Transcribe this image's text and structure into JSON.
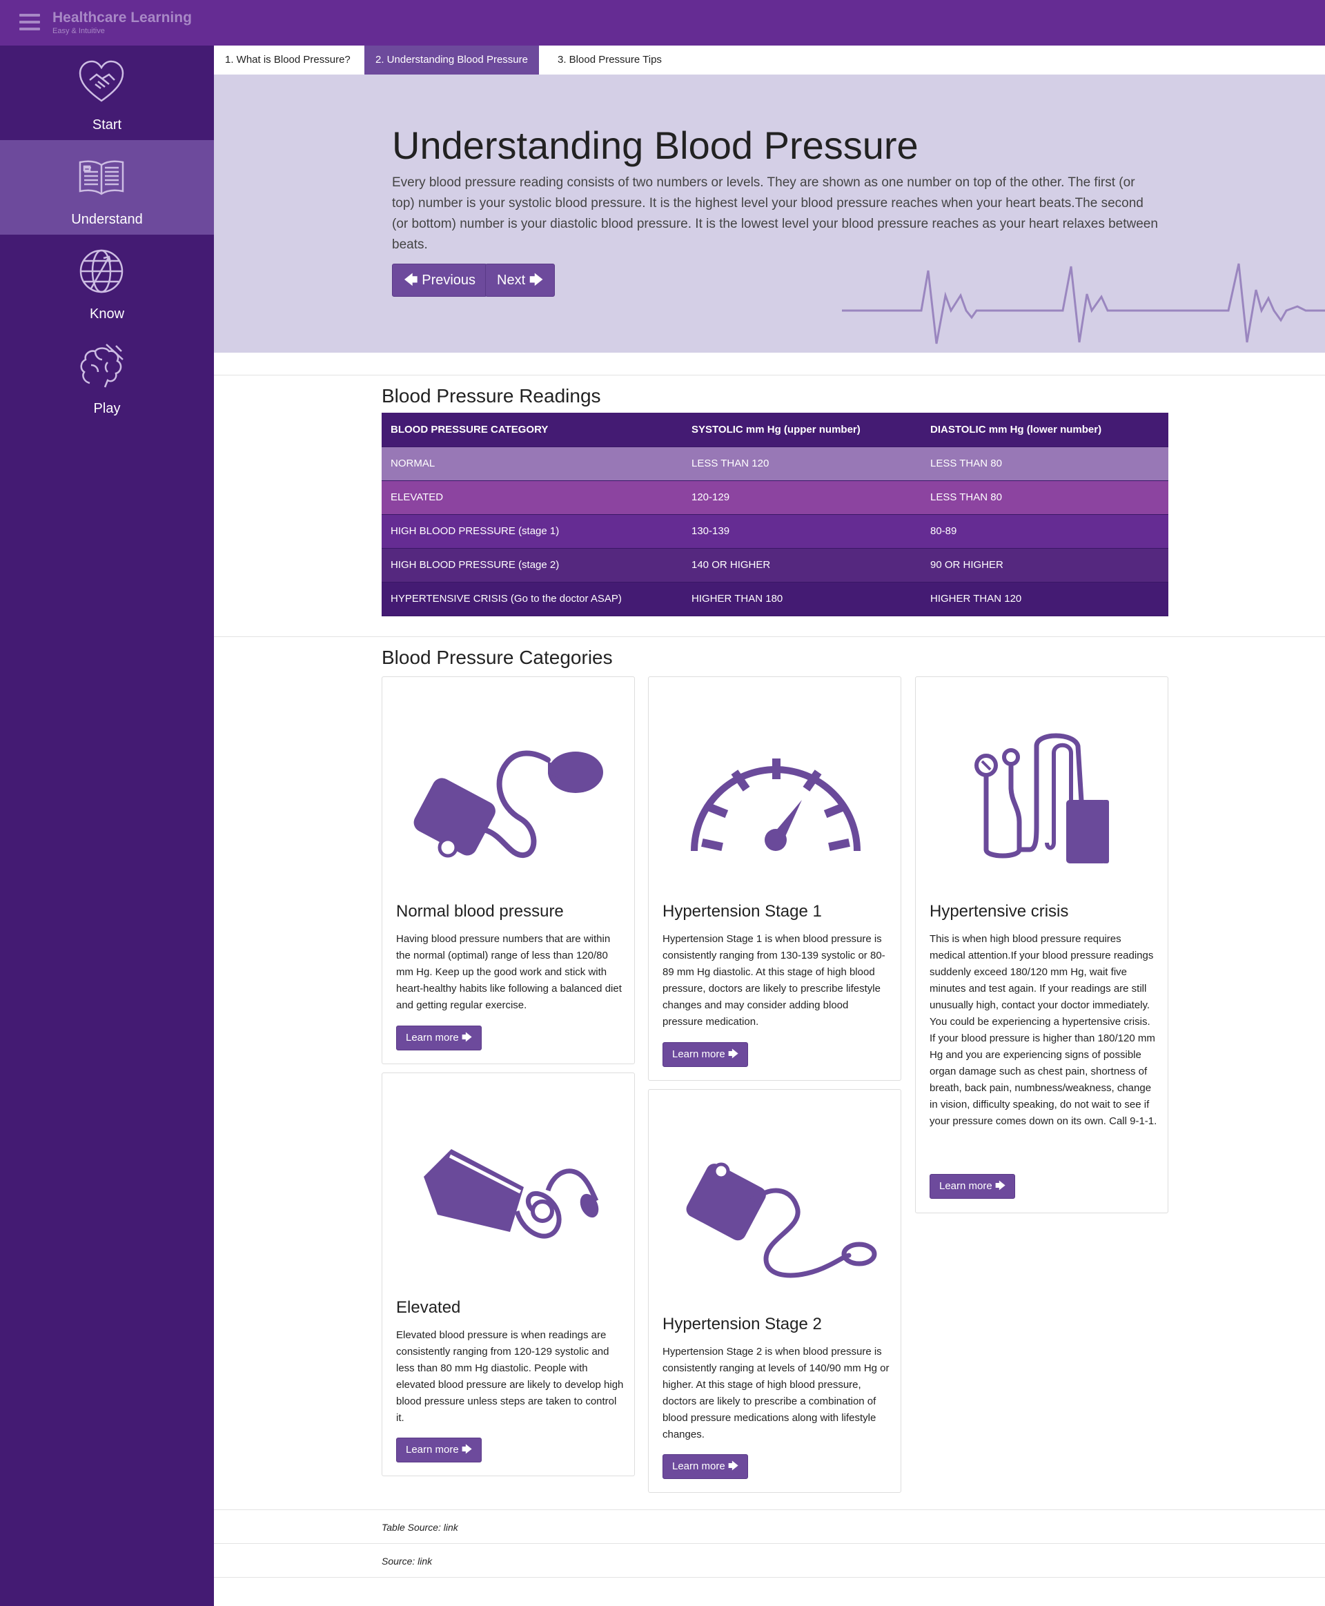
{
  "header": {
    "brand_title": "Healthcare Learning",
    "brand_subtitle": "Easy & Intuitive"
  },
  "sidebar": {
    "items": [
      {
        "label": "Start",
        "icon": "heart-handshake-icon"
      },
      {
        "label": "Understand",
        "icon": "open-book-icon"
      },
      {
        "label": "Know",
        "icon": "globe-arrow-icon"
      },
      {
        "label": "Play",
        "icon": "brain-icon"
      }
    ],
    "active_index": 1
  },
  "tabs": [
    {
      "label": "1. What is Blood Pressure?"
    },
    {
      "label": "2. Understanding Blood Pressure"
    },
    {
      "label": "3. Blood Pressure Tips"
    }
  ],
  "hero": {
    "title": "Understanding Blood Pressure",
    "body": "Every blood pressure reading consists of two numbers or levels. They are shown as one number on top of the other. The first (or top) number is your systolic blood pressure. It is the highest level your blood pressure reaches when your heart beats.The second (or bottom) number is your diastolic blood pressure. It is the lowest level your blood pressure reaches as your heart relaxes between beats.",
    "prev_label": "Previous",
    "next_label": "Next"
  },
  "readings": {
    "title": "Blood Pressure Readings",
    "headers": [
      "BLOOD PRESSURE CATEGORY",
      "SYSTOLIC mm Hg (upper number)",
      "DIASTOLIC mm Hg (lower number)"
    ],
    "rows": [
      [
        "NORMAL",
        "LESS THAN 120",
        "LESS THAN 80"
      ],
      [
        "ELEVATED",
        "120-129",
        "LESS THAN 80"
      ],
      [
        "HIGH BLOOD PRESSURE (stage 1)",
        "130-139",
        "80-89"
      ],
      [
        "HIGH BLOOD PRESSURE (stage 2)",
        "140 OR HIGHER",
        "90 OR HIGHER"
      ],
      [
        "HYPERTENSIVE CRISIS (Go to the doctor ASAP)",
        "HIGHER THAN 180",
        "HIGHER THAN 120"
      ]
    ]
  },
  "categories": {
    "title": "Blood Pressure Categories",
    "cards": [
      {
        "title": "Normal blood pressure",
        "body": "Having blood pressure numbers that are within the normal (optimal) range of less than 120/80 mm Hg. Keep up the good work and stick with heart-healthy habits like following a balanced diet and getting regular exercise.",
        "button": "Learn more",
        "icon": "blood-pressure-cuff-icon"
      },
      {
        "title": "Hypertension Stage 1",
        "body": "Hypertension Stage 1 is when blood pressure is consistently ranging from 130-139 systolic or 80-89 mm Hg diastolic. At this stage of high blood pressure, doctors are likely to prescribe lifestyle changes and may consider adding blood pressure medication.",
        "button": "Learn more",
        "icon": "gauge-icon"
      },
      {
        "title": "Hypertensive crisis",
        "body": "This is when high blood pressure requires medical attention.If your blood pressure readings suddenly exceed 180/120 mm Hg, wait five minutes and test again. If your readings are still unusually high, contact your doctor immediately. You could be experiencing a hypertensive crisis. If your blood pressure is higher than 180/120 mm Hg and you are experiencing signs of possible organ damage such as chest pain, shortness of breath, back pain, numbness/weakness, change in vision, difficulty speaking, do not wait to see if your pressure comes down on its own. Call 9-1-1.",
        "button": "Learn more",
        "icon": "stethoscope-icon"
      },
      {
        "title": "Elevated",
        "body": "Elevated blood pressure is when readings are consistently ranging from 120-129 systolic and less than 80 mm Hg diastolic. People with elevated blood pressure are likely to develop high blood pressure unless steps are taken to control it.",
        "button": "Learn more",
        "icon": "sphygmomanometer-icon"
      },
      {
        "title": "Hypertension Stage 2",
        "body": "Hypertension Stage 2 is when blood pressure is consistently ranging at levels of 140/90 mm Hg or higher. At this stage of high blood pressure, doctors are likely to prescribe a combination of blood pressure medications along with lifestyle changes.",
        "button": "Learn more",
        "icon": "pressure-monitor-icon"
      }
    ]
  },
  "footer": {
    "table_source": "Table Source: link",
    "source": "Source: link"
  },
  "colors": {
    "topbar": "#652c93",
    "sidebar": "#441b73",
    "accent": "#6d4a9c",
    "hero_bg": "#d4cfe6"
  }
}
